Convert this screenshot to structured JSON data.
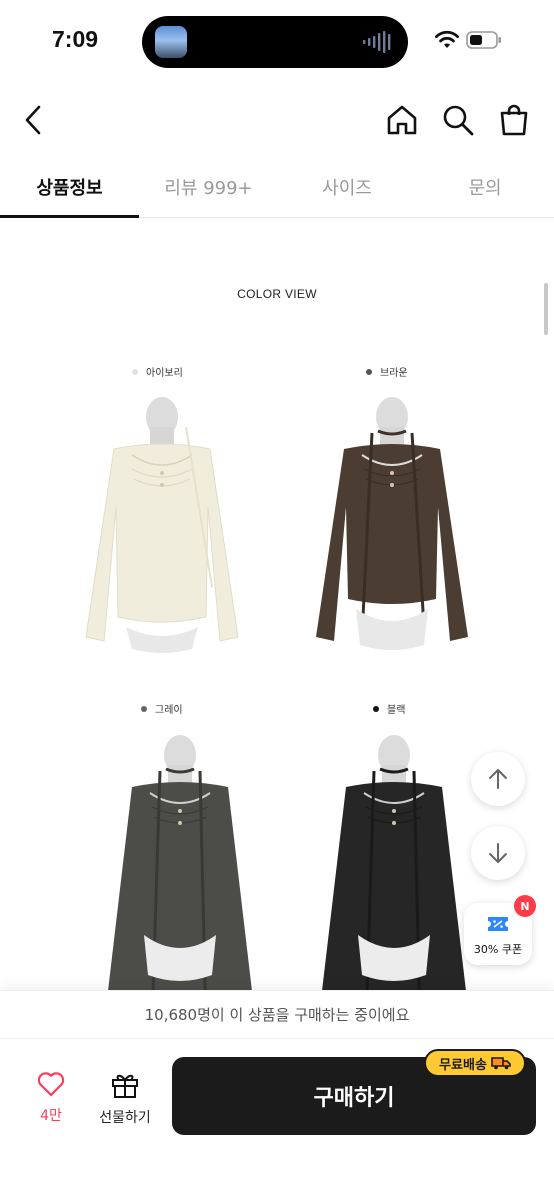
{
  "status_bar": {
    "time": "7:09"
  },
  "tabs": [
    {
      "label": "상품정보"
    },
    {
      "label": "리뷰 999+"
    },
    {
      "label": "사이즈"
    },
    {
      "label": "문의"
    }
  ],
  "content": {
    "heading": "COLOR VIEW",
    "swatches": [
      {
        "label": "아이보리",
        "color": "#e8e6e0"
      },
      {
        "label": "브라운",
        "color": "#555555"
      },
      {
        "label": "그레이",
        "color": "#666666"
      },
      {
        "label": "블랙",
        "color": "#111111"
      }
    ]
  },
  "floating": {
    "coupon_label": "30% 쿠폰",
    "coupon_badge": "N"
  },
  "bottom": {
    "buying_notice": "10,680명이 이 상품을 구매하는 중이에요",
    "like_count": "4만",
    "gift_label": "선물하기",
    "buy_label": "구매하기",
    "free_shipping": "무료배송"
  },
  "colors": {
    "accent_pink": "#ff3b5c",
    "shipping_badge": "#ffc933",
    "buy_button": "#1b1b1b"
  }
}
